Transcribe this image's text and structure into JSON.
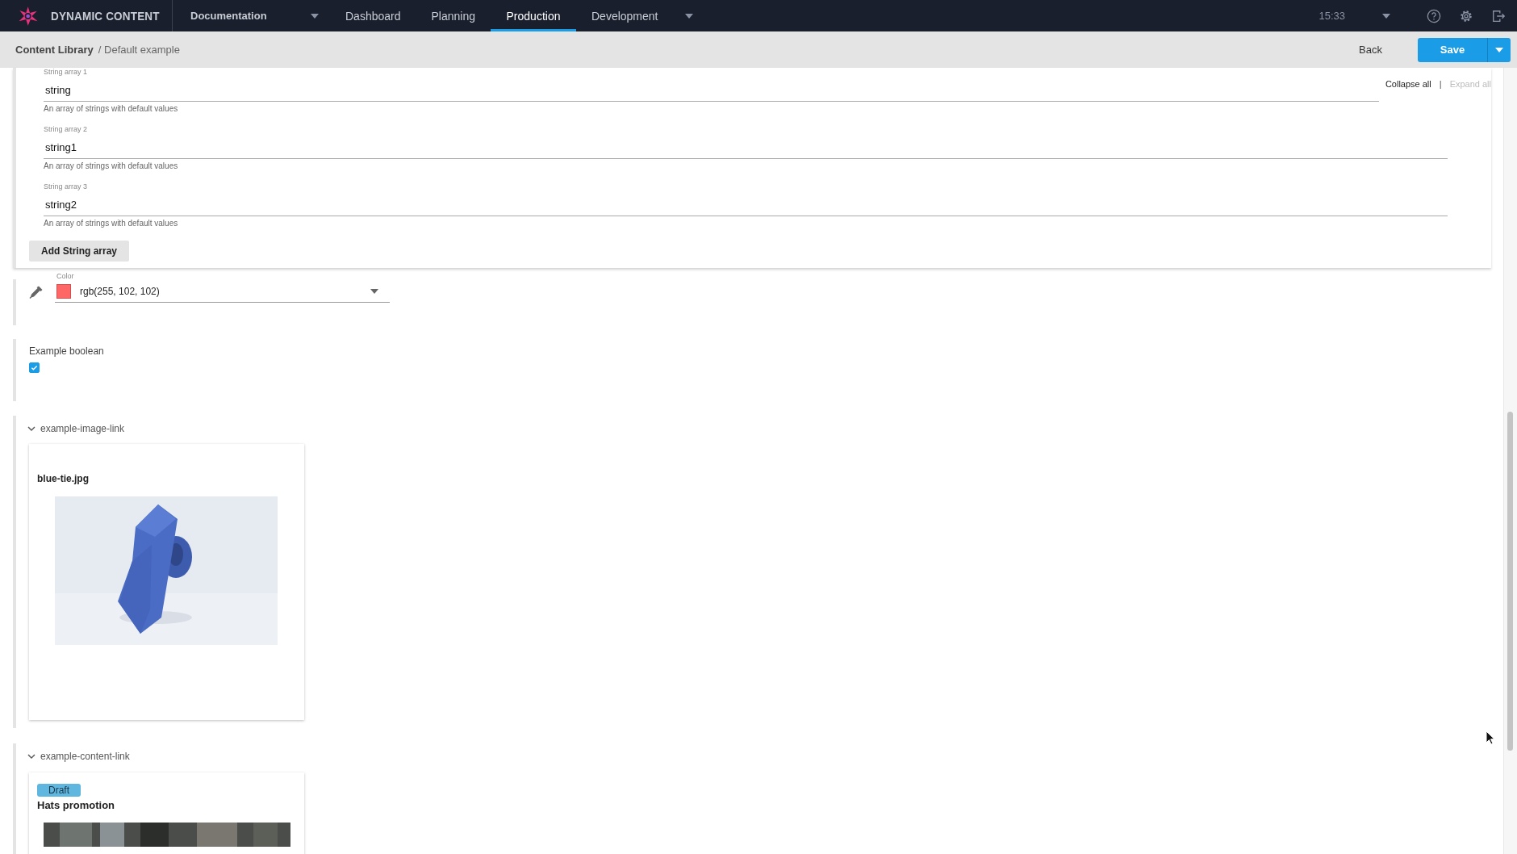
{
  "app": {
    "name": "DYNAMIC CONTENT"
  },
  "nav": {
    "hub": "Documentation",
    "tabs": [
      {
        "label": "Dashboard",
        "selected": false,
        "menu": false
      },
      {
        "label": "Planning",
        "selected": false,
        "menu": false
      },
      {
        "label": "Production",
        "selected": true,
        "menu": false
      },
      {
        "label": "Development",
        "selected": false,
        "menu": true
      }
    ],
    "time": "15:33"
  },
  "breadcrumb": {
    "root": "Content Library",
    "current": "/ Default example"
  },
  "actions": {
    "back": "Back",
    "save": "Save"
  },
  "string_array": {
    "fields": [
      {
        "label": "String array 1",
        "value": "string",
        "helper": "An array of strings with default values"
      },
      {
        "label": "String array 2",
        "value": "string1",
        "helper": "An array of strings with default values"
      },
      {
        "label": "String array 3",
        "value": "string2",
        "helper": "An array of strings with default values"
      }
    ],
    "add_button": "Add String array",
    "collapse": "Collapse all",
    "separator": "|",
    "expand": "Expand all",
    "expand_disabled": true
  },
  "color": {
    "label": "Color",
    "value": "rgb(255, 102, 102)"
  },
  "boolean": {
    "label": "Example boolean",
    "checked": true
  },
  "image_link": {
    "title": "example-image-link",
    "expanded": true,
    "file": "blue-tie.jpg"
  },
  "content_link": {
    "title": "example-content-link",
    "expanded": true,
    "status": "Draft",
    "name": "Hats promotion"
  }
}
